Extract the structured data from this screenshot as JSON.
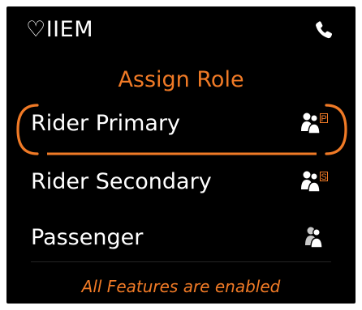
{
  "header": {
    "brand": "♡IIEM",
    "phone_icon": "phone-icon"
  },
  "title": "Assign Role",
  "roles": [
    {
      "label": "Rider Primary",
      "badge": "P",
      "icon": "rider-primary-icon",
      "selected": true
    },
    {
      "label": "Rider Secondary",
      "badge": "S",
      "icon": "rider-secondary-icon",
      "selected": false
    },
    {
      "label": "Passenger",
      "badge": "",
      "icon": "passenger-icon",
      "selected": false
    }
  ],
  "footer": "All Features are enabled",
  "colors": {
    "accent": "#f07a26",
    "background": "#000000",
    "text": "#ffffff"
  }
}
